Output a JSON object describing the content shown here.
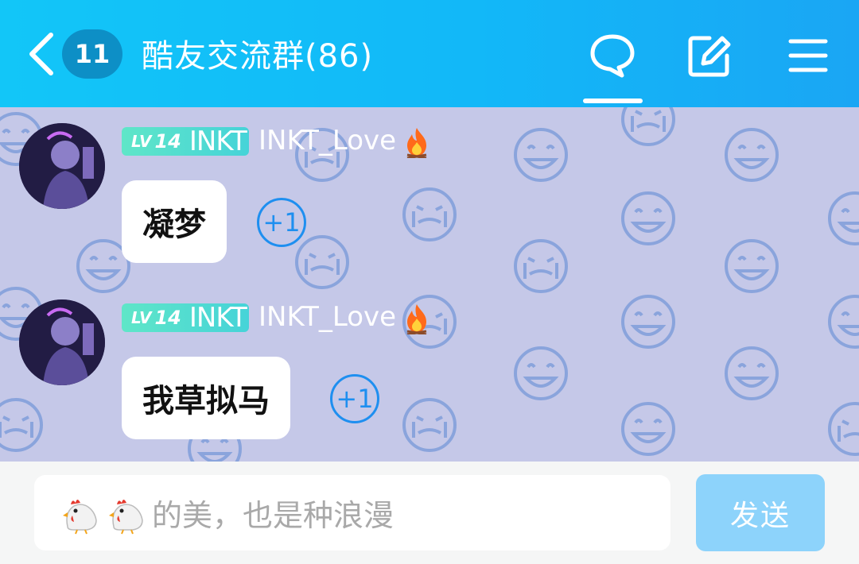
{
  "header": {
    "unread_count": "11",
    "title": "酷友交流群(86)",
    "icons": [
      "back-icon",
      "chat-bubble-icon",
      "edit-icon",
      "menu-icon"
    ]
  },
  "messages": [
    {
      "level_prefix": "LV",
      "level_number": "14",
      "tag": "INKT",
      "username": "INKT_Love",
      "text": "凝梦",
      "plus": "+1"
    },
    {
      "level_prefix": "LV",
      "level_number": "14",
      "tag": "INKT",
      "username": "INKT_Love",
      "text": "我草拟马",
      "plus": "+1"
    }
  ],
  "input": {
    "placeholder": "的美，也是种浪漫"
  },
  "send_label": "发送",
  "colors": {
    "header": "#12b8f8",
    "chat_background": "#c5c8e8",
    "level_tag": "#4fd9d4",
    "plus_button": "#1e8ff0",
    "send_button": "#8dd3fb"
  }
}
